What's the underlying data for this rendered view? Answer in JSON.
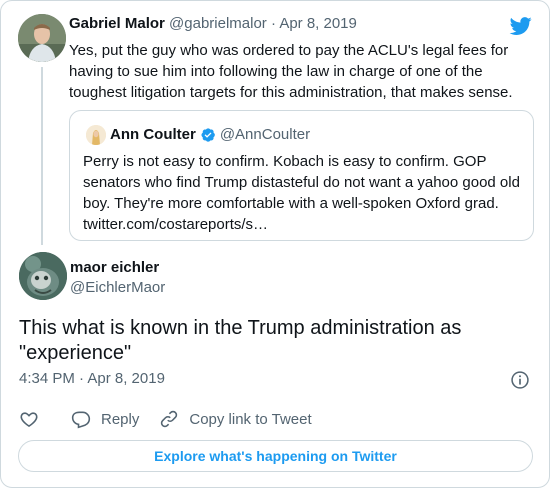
{
  "brand": {
    "accent": "#1d9bf0",
    "border": "#cfd9de",
    "secondary_text": "#536471"
  },
  "parent_tweet": {
    "author_name": "Gabriel Malor",
    "author_handle": "@gabrielmalor",
    "separator": "·",
    "date": "Apr 8, 2019",
    "text": "Yes, put the guy who was ordered to pay the ACLU's legal fees for having to sue him into following the law in charge of one of the toughest litigation targets for this administration, that makes sense."
  },
  "quoted_tweet": {
    "author_name": "Ann Coulter",
    "verified": true,
    "author_handle": "@AnnCoulter",
    "text": "Perry is not easy to confirm.  Kobach is easy to confirm. GOP senators who find Trump distasteful do not want a yahoo good old boy. They're more comfortable with a well-spoken Oxford grad. twitter.com/costareports/s…"
  },
  "main_tweet": {
    "author_name": "maor eichler",
    "author_handle": "@EichlerMaor",
    "text": "This what is known in the Trump administration as \"experience\"",
    "timestamp": "4:34 PM · Apr 8, 2019"
  },
  "actions": {
    "like_icon": "heart-icon",
    "reply_label": "Reply",
    "copy_link_label": "Copy link to Tweet"
  },
  "explore_button": {
    "label": "Explore what's happening on Twitter"
  }
}
